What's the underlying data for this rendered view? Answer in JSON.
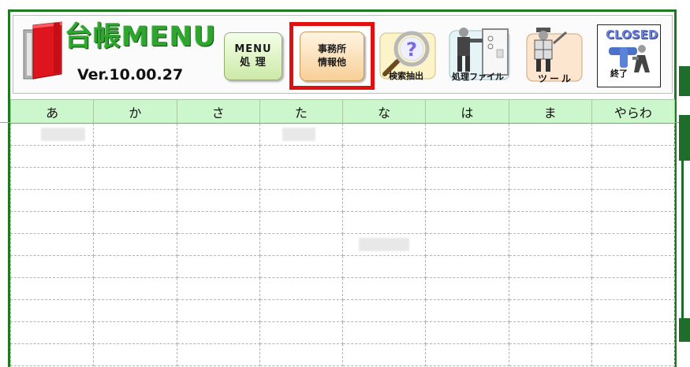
{
  "app": {
    "title": "台帳MENU",
    "version": "Ver.10.00.27"
  },
  "toolbar": {
    "menu_button": {
      "line1": "MENU",
      "line2": "処 理"
    },
    "office_button": {
      "line1": "事務所",
      "line2": "情報他"
    },
    "search_button": {
      "label": "検索抽出"
    },
    "filing_button": {
      "label": "処理ファイル"
    },
    "tools_button": {
      "label": "ツール"
    },
    "closed_button": {
      "title": "CLOSED",
      "label": "終了"
    }
  },
  "table": {
    "headers": [
      "あ",
      "か",
      "さ",
      "た",
      "な",
      "は",
      "ま",
      "やらわ"
    ]
  },
  "colors": {
    "frame_green": "#1e7a1e",
    "header_bg": "#ccf7cc",
    "highlight_red": "#e01010"
  }
}
